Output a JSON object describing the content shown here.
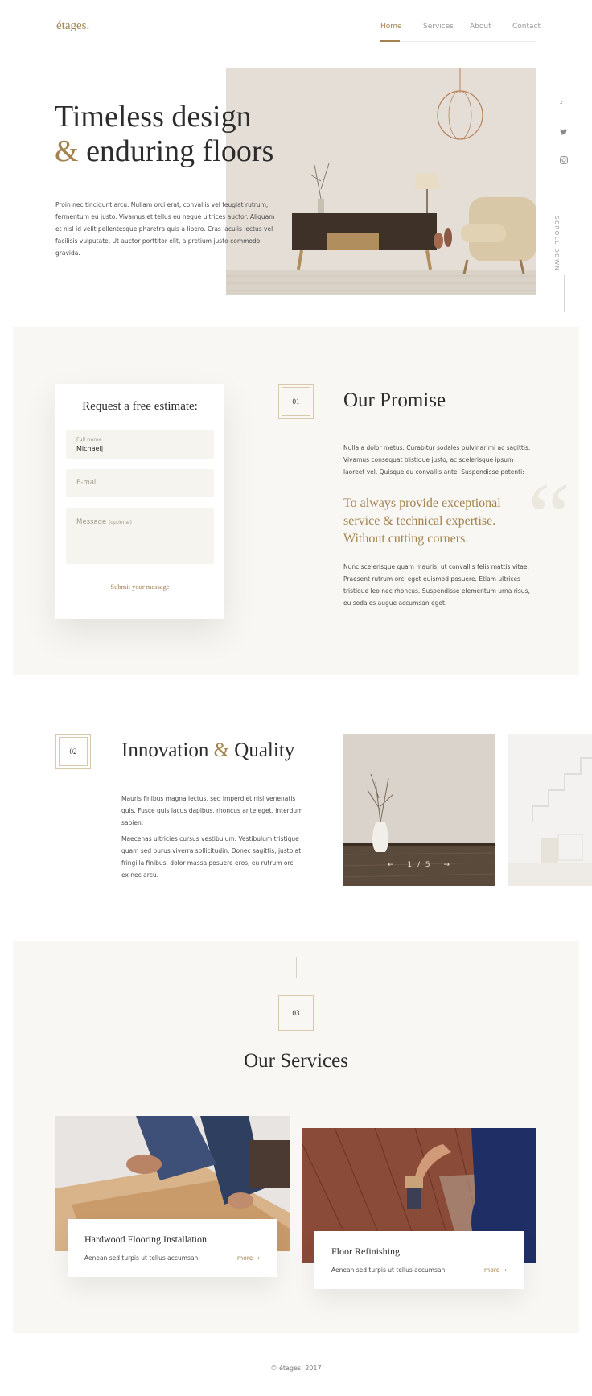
{
  "header": {
    "logo": "étages.",
    "nav": [
      "Home",
      "Services",
      "About",
      "Contact"
    ],
    "active_nav": "Home"
  },
  "hero": {
    "title_line1": "Timeless design",
    "title_amp": "&",
    "title_line2": "enduring floors",
    "text": "Proin nec tincidunt arcu. Nullam orci erat, convallis vel feugiat rutrum, fermentum eu justo. Vivamus et tellus eu neque ultrices auctor. Aliquam et nisl id velit pellentesque pharetra quis a libero. Cras iaculis lectus vel facilisis vulputate. Ut auctor porttitor elit, a pretium justo commodo gravida.",
    "social_icons": [
      "facebook-icon",
      "twitter-icon",
      "instagram-icon"
    ],
    "scroll_label": "SCROLL DOWN"
  },
  "estimate": {
    "title": "Request a free estimate:",
    "fullname_label": "Full name",
    "fullname_value": "Michael|",
    "email_placeholder": "E-mail",
    "message_label": "Message",
    "message_optional": "(optional)",
    "submit_label": "Submit your message"
  },
  "promise": {
    "number": "01",
    "title": "Our Promise",
    "text1": "Nulla a dolor metus. Curabitur sodales pulvinar mi ac sagittis. Vivamus consequat tristique justo, ac scelerisque ipsum laoreet vel. Quisque eu convallis ante. Suspendisse potenti:",
    "quote": "To always provide exceptional service & technical expertise. Without cutting corners.",
    "text2": "Nunc scelerisque quam mauris, ut convallis felis mattis vitae. Praesent rutrum orci eget euismod posuere. Etiam ultrices tristique leo nec rhoncus. Suspendisse elementum urna risus, eu sodales augue accumsan eget."
  },
  "innovation": {
    "number": "02",
    "title_part1": "Innovation",
    "title_amp": "&",
    "title_part2": "Quality",
    "text1": "Mauris finibus magna lectus, sed imperdiet nisl venenatis quis. Fusce quis lacus dapibus, rhoncus ante eget, interdum sapien.",
    "text2": "Maecenas ultricies cursus vestibulum. Vestibulum tristique quam sed purus viverra sollicitudin. Donec sagittis, justo at fringilla finibus, dolor massa posuere eros, eu rutrum orci ex nec arcu.",
    "slider_prev": "←",
    "slider_counter": "1 / 5",
    "slider_next": "→"
  },
  "services": {
    "number": "03",
    "title": "Our Services",
    "items": [
      {
        "title": "Hardwood Flooring Installation",
        "desc": "Aenean sed turpis ut tellus accumsan.",
        "more": "more →"
      },
      {
        "title": "Floor Refinishing",
        "desc": "Aenean sed turpis ut tellus accumsan.",
        "more": "more →"
      }
    ]
  },
  "footer": {
    "copyright": "© étages. 2017"
  }
}
